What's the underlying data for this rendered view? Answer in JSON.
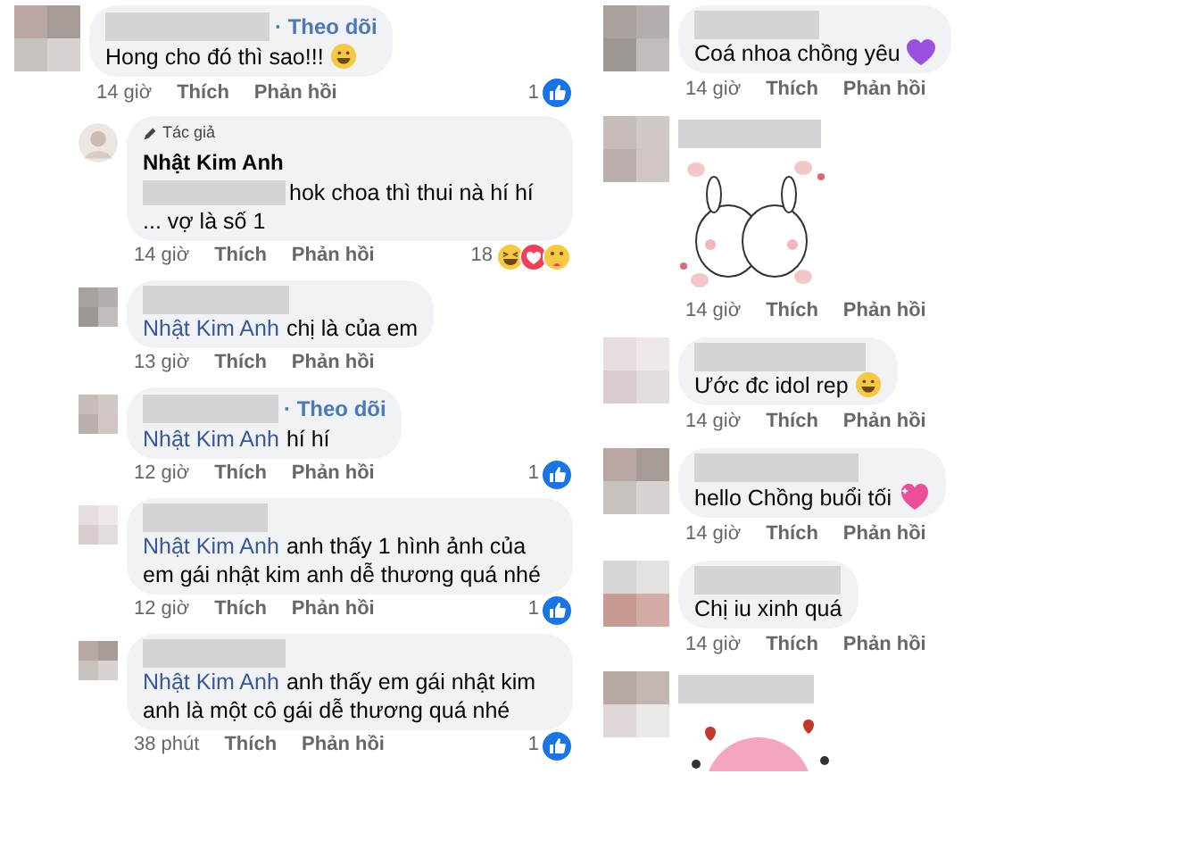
{
  "columns": [
    {
      "comments": [
        {
          "kind": "text",
          "follow": "· Theo dõi",
          "text": "Hong cho đó thì sao!!!",
          "emoji": {
            "kind": "grin"
          },
          "time": "14 giờ",
          "like": "Thích",
          "reply": "Phản hồi",
          "reaction_count": "1",
          "reactions": [
            {
              "kind": "like"
            }
          ],
          "children": [
            {
              "kind": "text",
              "badge": "Tác giả",
              "name": "Nhật Kim Anh",
              "redacted_prefix": true,
              "text": "hok choa thì thui nà hí hí ... vợ là số 1",
              "time": "14 giờ",
              "like": "Thích",
              "reply": "Phản hồi",
              "reaction_count": "18",
              "reactions": [
                {
                  "kind": "haha"
                },
                {
                  "kind": "love"
                },
                {
                  "kind": "care"
                }
              ]
            },
            {
              "kind": "text",
              "mention": "Nhật Kim Anh",
              "text": "chị là của em",
              "time": "13 giờ",
              "like": "Thích",
              "reply": "Phản hồi"
            },
            {
              "kind": "text",
              "follow": "· Theo dõi",
              "mention": "Nhật Kim Anh",
              "text": "hí hí",
              "time": "12 giờ",
              "like": "Thích",
              "reply": "Phản hồi",
              "reaction_count": "1",
              "reactions": [
                {
                  "kind": "like"
                }
              ]
            },
            {
              "kind": "text",
              "mention": "Nhật Kim Anh",
              "text": "anh thấy 1 hình ảnh của em gái nhật kim anh dễ thương quá nhé",
              "time": "12 giờ",
              "like": "Thích",
              "reply": "Phản hồi",
              "reaction_count": "1",
              "reactions": [
                {
                  "kind": "like"
                }
              ]
            },
            {
              "kind": "text",
              "mention": "Nhật Kim Anh",
              "text": "anh thấy em gái nhật kim anh là một cô gái dễ thương quá nhé",
              "time": "38 phút",
              "like": "Thích",
              "reply": "Phản hồi",
              "reaction_count": "1",
              "reactions": [
                {
                  "kind": "like"
                }
              ]
            }
          ]
        }
      ]
    },
    {
      "comments": [
        {
          "kind": "text",
          "text": "Coá nhoa chồng yêu",
          "emoji": {
            "kind": "purple-heart"
          },
          "time": "14 giờ",
          "like": "Thích",
          "reply": "Phản hồi"
        },
        {
          "kind": "sticker",
          "time": "14 giờ",
          "like": "Thích",
          "reply": "Phản hồi"
        },
        {
          "kind": "text",
          "text": "Ước đc idol rep",
          "emoji": {
            "kind": "grin"
          },
          "time": "14 giờ",
          "like": "Thích",
          "reply": "Phản hồi"
        },
        {
          "kind": "text",
          "text": "hello Chồng buổi tối",
          "emoji": {
            "kind": "sparkling-heart"
          },
          "time": "14 giờ",
          "like": "Thích",
          "reply": "Phản hồi"
        },
        {
          "kind": "text",
          "text": "Chị iu xinh quá",
          "time": "14 giờ",
          "like": "Thích",
          "reply": "Phản hồi"
        },
        {
          "kind": "sticker",
          "cut": true
        }
      ]
    }
  ]
}
